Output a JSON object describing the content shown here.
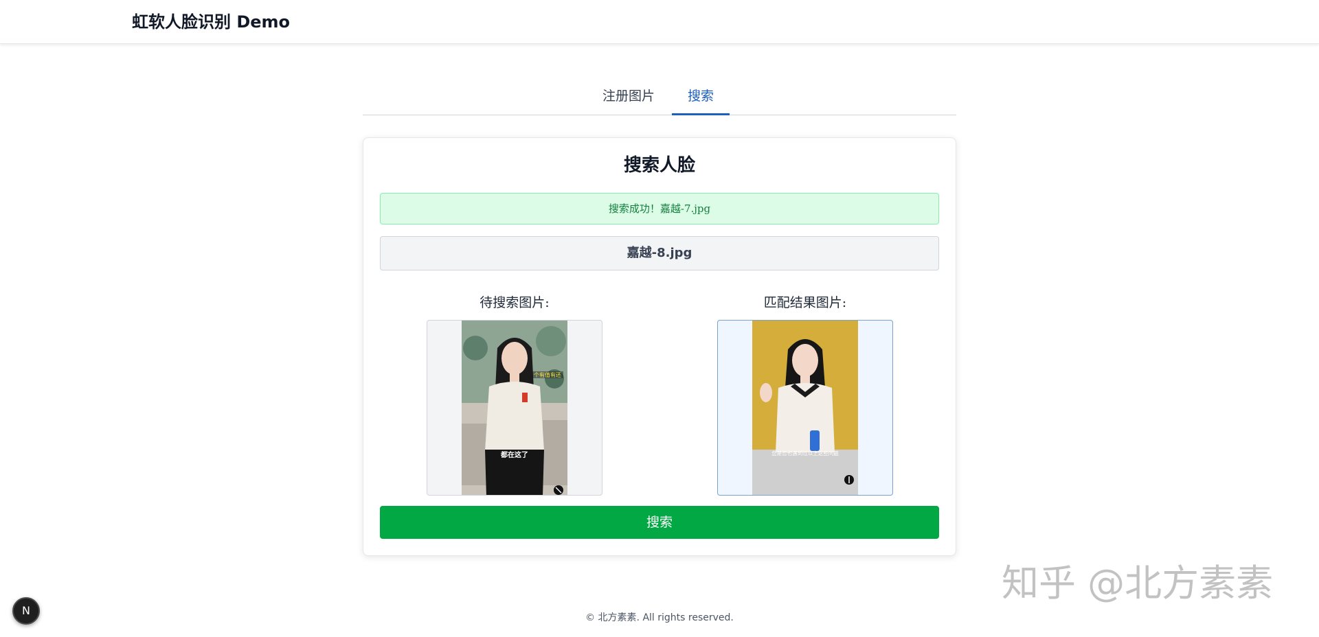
{
  "header": {
    "title": "虹软人脸识别 Demo"
  },
  "tabs": [
    {
      "label": "注册图片",
      "active": false
    },
    {
      "label": "搜索",
      "active": true
    }
  ],
  "card": {
    "title": "搜索人脸",
    "success_message": "搜索成功！嘉越-7.jpg",
    "selected_file": "嘉越-8.jpg",
    "query_label": "待搜索图片:",
    "result_label": "匹配结果图片:",
    "query_caption_top": "个有值有还",
    "query_caption_bottom": "都在这了",
    "result_caption": "您是否也遇到过以上这些问题",
    "search_button": "搜索"
  },
  "watermark": "知乎 @北方素素",
  "footer": {
    "text": "© 北方素素. All rights reserved."
  },
  "floating_badge": {
    "label": "N"
  },
  "colors": {
    "accent": "#1d5fbf",
    "success_bg": "#dcfce7",
    "success_text": "#15803d",
    "primary_button": "#02a844"
  },
  "icons": [
    "watermark-logo-icon",
    "next-badge-icon"
  ]
}
